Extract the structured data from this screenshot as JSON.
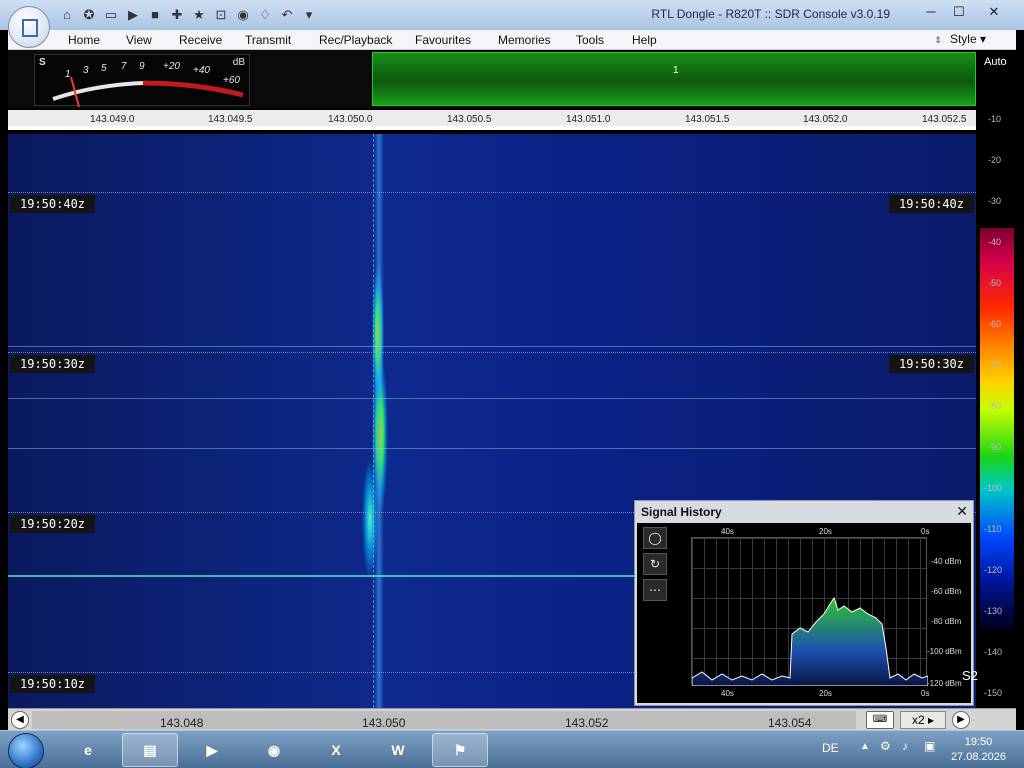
{
  "window": {
    "title": "RTL Dongle - R820T :: SDR Console v3.0.19"
  },
  "menu": {
    "items": [
      "Home",
      "View",
      "Receive",
      "Transmit",
      "Rec/Playback",
      "Favourites",
      "Memories",
      "Tools",
      "Help"
    ],
    "style_label": "Style"
  },
  "smeter": {
    "s_label": "S",
    "db_label": "dB",
    "scale": [
      "1",
      "3",
      "5",
      "7",
      "9",
      "+20",
      "+40",
      "+60"
    ]
  },
  "overview": {
    "marker": "1"
  },
  "freq_scale": {
    "labels": [
      "143.049.0",
      "143.049.5",
      "143.050.0",
      "143.050.5",
      "143.051.0",
      "143.051.5",
      "143.052.0",
      "143.052.5"
    ]
  },
  "db_scale": {
    "auto_label": "Auto",
    "labels": [
      "-10",
      "-20",
      "-30",
      "-40",
      "-50",
      "-60",
      "-70",
      "-80",
      "-90",
      "-100",
      "-110",
      "-120",
      "-130",
      "-140",
      "-150"
    ]
  },
  "waterfall": {
    "timestamps": [
      "19:50:40z",
      "19:50:30z",
      "19:50:20z",
      "19:50:10z"
    ]
  },
  "signal_history": {
    "title": "Signal History",
    "top_labels": [
      "40s",
      "20s",
      "0s"
    ],
    "bottom_labels": [
      "40s",
      "20s",
      "0s"
    ],
    "y_labels": [
      "-40 dBm",
      "-60 dBm",
      "-80 dBm",
      "-100 dBm",
      "-120 dBm"
    ],
    "s_reading": "S2"
  },
  "bottom_bar": {
    "freq_labels": [
      "143.048",
      "143.050",
      "143.052",
      "143.054"
    ],
    "zoom": "x2"
  },
  "taskbar": {
    "lang": "DE",
    "time": "19:50",
    "date": "27.08.2026"
  },
  "colors": {
    "accent": "#2fc52f",
    "waterfall_bg": "#0e2a8e",
    "signal_peak": "#ffd000"
  }
}
